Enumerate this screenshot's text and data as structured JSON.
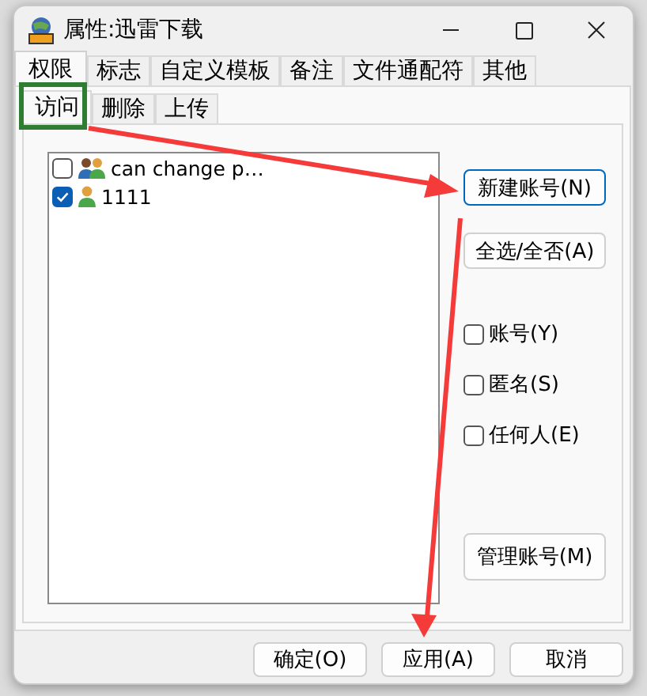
{
  "window": {
    "title": "属性:迅雷下载"
  },
  "tabs": [
    {
      "label": "权限",
      "selected": true
    },
    {
      "label": "标志",
      "selected": false
    },
    {
      "label": "自定义模板",
      "selected": false
    },
    {
      "label": "备注",
      "selected": false
    },
    {
      "label": "文件通配符",
      "selected": false
    },
    {
      "label": "其他",
      "selected": false
    }
  ],
  "subtabs": [
    {
      "label": "访问",
      "selected": true
    },
    {
      "label": "删除",
      "selected": false
    },
    {
      "label": "上传",
      "selected": false
    }
  ],
  "accounts": [
    {
      "name": "can change p…",
      "checked": false,
      "kind": "group"
    },
    {
      "name": "1111",
      "checked": true,
      "kind": "user"
    }
  ],
  "side_buttons": [
    {
      "label": "新建账号(N)",
      "focused": true
    },
    {
      "label": "全选/全否(A)",
      "focused": false
    }
  ],
  "options": [
    {
      "label": "账号(Y)",
      "checked": false
    },
    {
      "label": "匿名(S)",
      "checked": false
    },
    {
      "label": "任何人(E)",
      "checked": false
    }
  ],
  "manage_button": {
    "label": "管理账号(M)",
    "focused": false
  },
  "buttons": [
    "确定(O)",
    "应用(A)",
    "取消"
  ]
}
